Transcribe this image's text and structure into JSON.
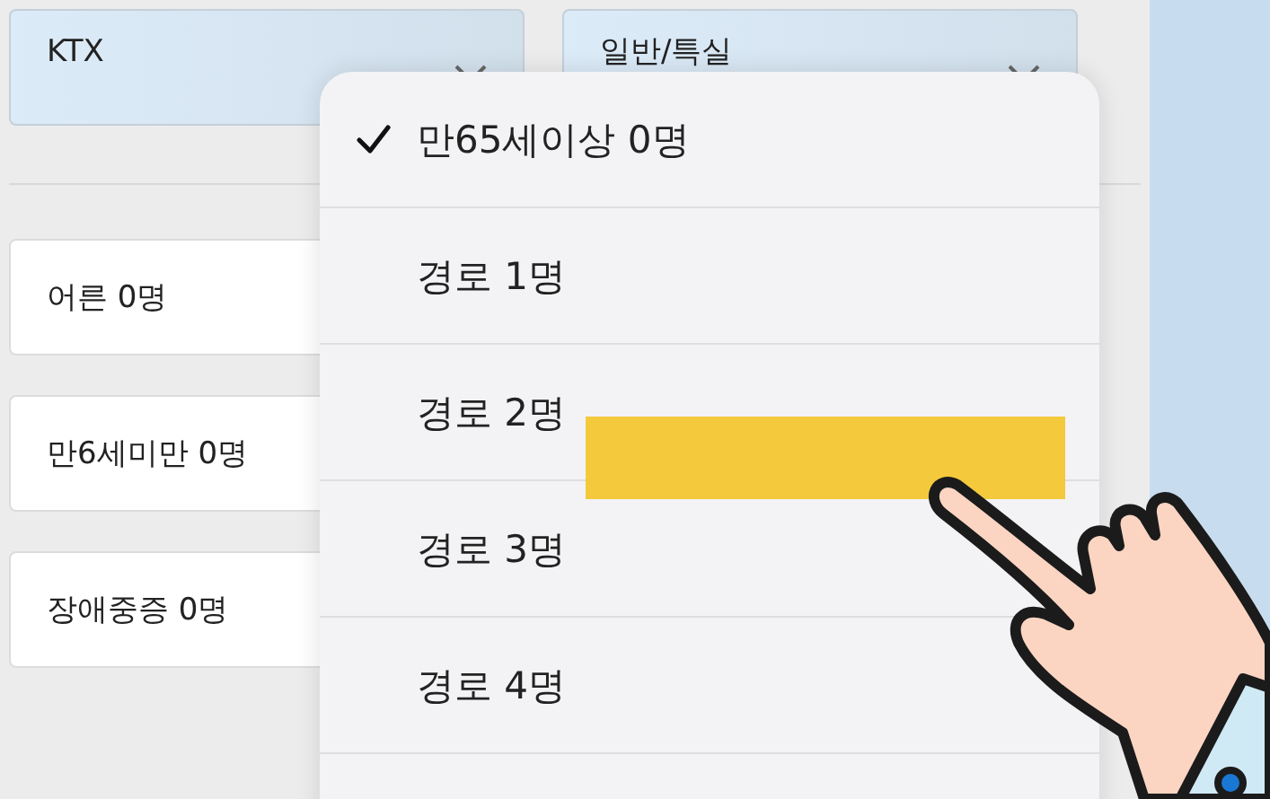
{
  "selects": [
    {
      "value": "KTX"
    },
    {
      "value": "일반/특실"
    }
  ],
  "passenger_fields": [
    {
      "value": "어른 0명"
    },
    {
      "value": "만6세미만 0명"
    },
    {
      "value": "장애중증 0명"
    }
  ],
  "dropdown_menu": {
    "items": [
      {
        "label": "만65세이상 0명",
        "selected": true
      },
      {
        "label": "경로 1명",
        "selected": false
      },
      {
        "label": "경로 2명",
        "selected": false
      },
      {
        "label": "경로 3명",
        "selected": false
      },
      {
        "label": "경로 4명",
        "selected": false
      }
    ]
  }
}
